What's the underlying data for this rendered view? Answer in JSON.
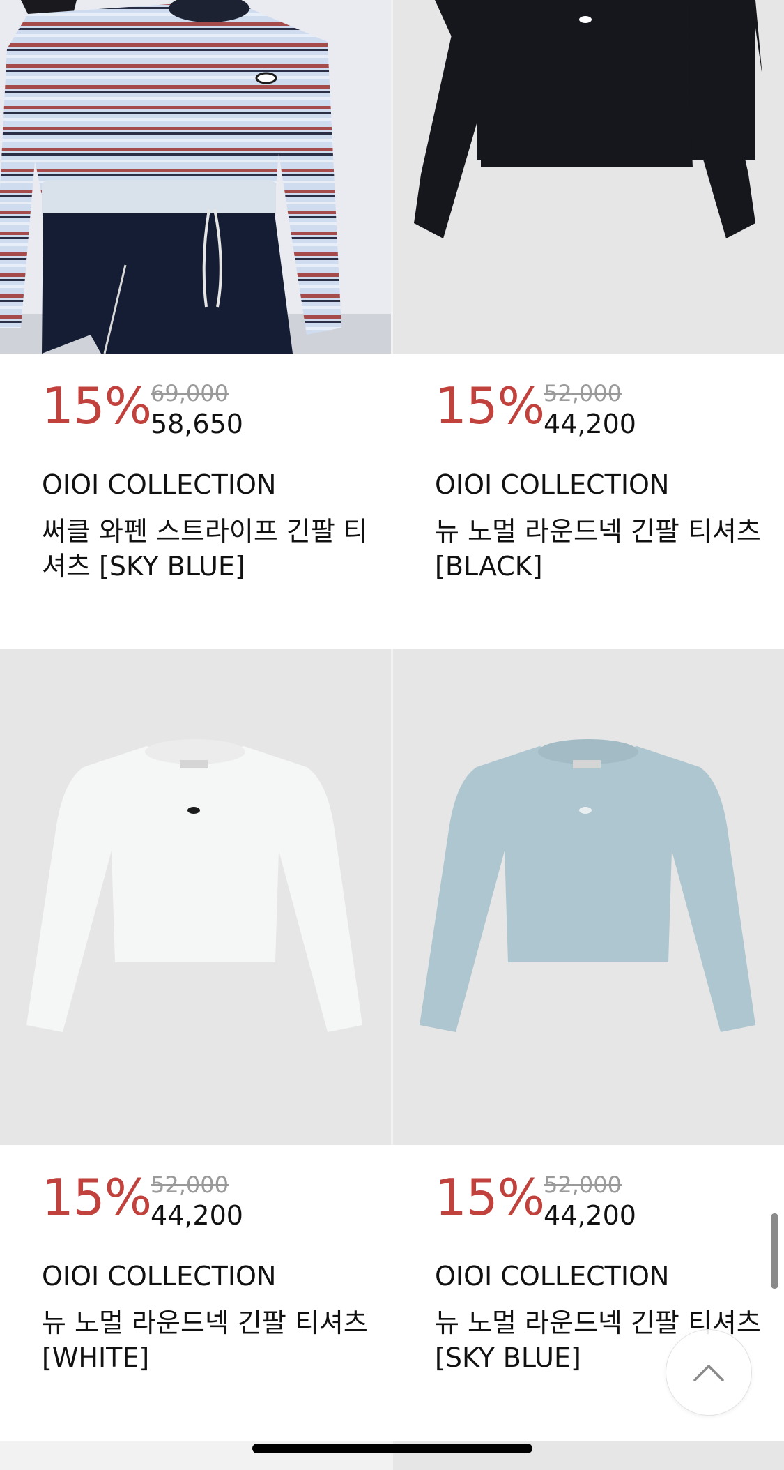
{
  "products": [
    {
      "discount": "15%",
      "original_price": "69,000",
      "sale_price": "58,650",
      "brand": "OIOI COLLECTION",
      "name": "써클 와펜 스트라이프 긴팔 티셔츠 [SKY BLUE]",
      "image": "striped-longsleeve-model-photo"
    },
    {
      "discount": "15%",
      "original_price": "52,000",
      "sale_price": "44,200",
      "brand": "OIOI COLLECTION",
      "name": "뉴 노멀 라운드넥 긴팔 티셔츠 [BLACK]",
      "image": "black-longsleeve-flat"
    },
    {
      "discount": "15%",
      "original_price": "52,000",
      "sale_price": "44,200",
      "brand": "OIOI COLLECTION",
      "name": "뉴 노멀 라운드넥 긴팔 티셔츠 [WHITE]",
      "image": "white-longsleeve-flat"
    },
    {
      "discount": "15%",
      "original_price": "52,000",
      "sale_price": "44,200",
      "brand": "OIOI COLLECTION",
      "name": "뉴 노멀 라운드넥 긴팔 티셔츠 [SKY BLUE]",
      "image": "skyblue-longsleeve-flat"
    }
  ],
  "scroll_top_button": {
    "icon": "chevron-up-icon"
  },
  "colors": {
    "discount": "#c1413d",
    "image_bg": "#e6e6e6",
    "text": "#111111",
    "strike": "#9a9a9a"
  }
}
